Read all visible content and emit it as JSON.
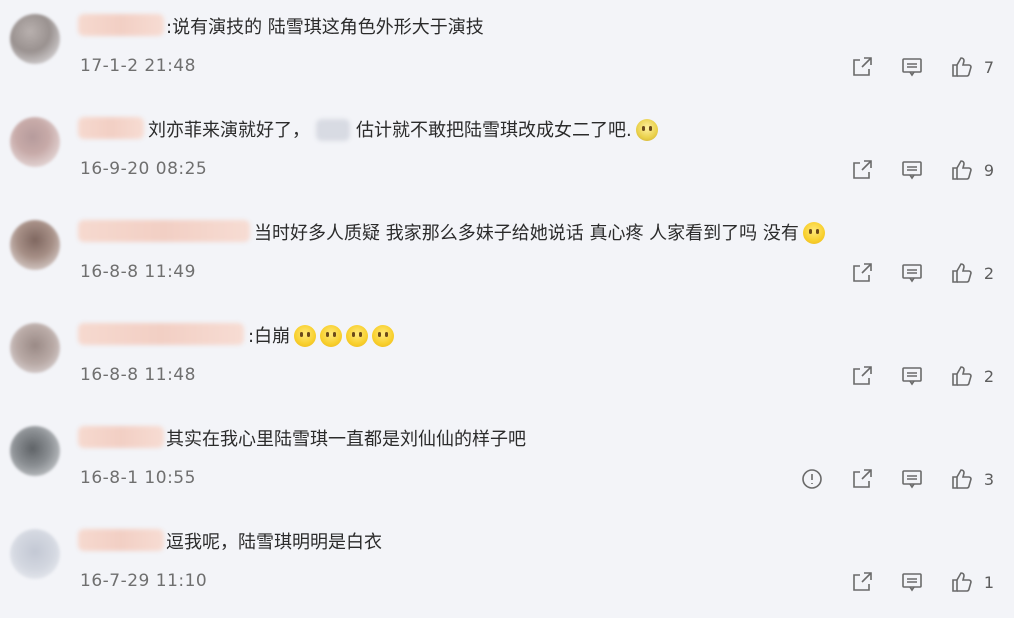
{
  "comments": [
    {
      "text": ":说有演技的 陆雪琪这角色外形大于演技",
      "time": "17-1-2 21:48",
      "likes": "7",
      "emojis": 0
    },
    {
      "text_pre": "刘亦菲来演就好了，",
      "text_post": "估计就不敢把陆雪琪改成女二了吧.",
      "time": "16-9-20 08:25",
      "likes": "9",
      "emojis": 1
    },
    {
      "text": "当时好多人质疑  我家那么多妹子给她说话  真心疼  人家看到了吗  没有",
      "time": "16-8-8 11:49",
      "likes": "2",
      "emojis": 1
    },
    {
      "text": ":白崩",
      "time": "16-8-8 11:48",
      "likes": "2",
      "emojis": 4
    },
    {
      "text": "其实在我心里陆雪琪一直都是刘仙仙的样子吧",
      "time": "16-8-1 10:55",
      "likes": "3",
      "emojis": 0
    },
    {
      "text": "逗我呢，陆雪琪明明是白衣",
      "time": "16-7-29 11:10",
      "likes": "1",
      "emojis": 0
    }
  ],
  "icons": {
    "share": "share-icon",
    "reply": "comment-icon",
    "like": "thumbs-up-icon",
    "report": "report-icon"
  },
  "colors": {
    "background": "#f3f4f8",
    "text": "#2b2b2b",
    "meta": "#6f6f6f"
  }
}
